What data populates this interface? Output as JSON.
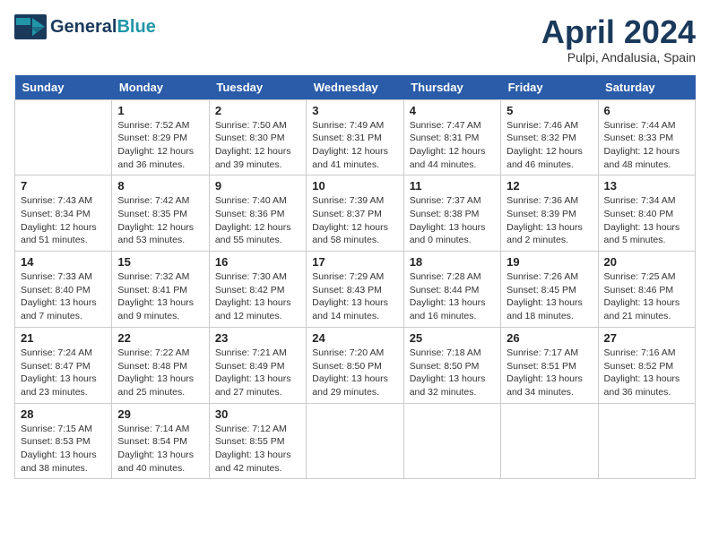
{
  "header": {
    "logo_general": "General",
    "logo_blue": "Blue",
    "month_title": "April 2024",
    "location": "Pulpi, Andalusia, Spain"
  },
  "days_of_week": [
    "Sunday",
    "Monday",
    "Tuesday",
    "Wednesday",
    "Thursday",
    "Friday",
    "Saturday"
  ],
  "weeks": [
    [
      {
        "day": "",
        "sunrise": "",
        "sunset": "",
        "daylight": ""
      },
      {
        "day": "1",
        "sunrise": "Sunrise: 7:52 AM",
        "sunset": "Sunset: 8:29 PM",
        "daylight": "Daylight: 12 hours and 36 minutes."
      },
      {
        "day": "2",
        "sunrise": "Sunrise: 7:50 AM",
        "sunset": "Sunset: 8:30 PM",
        "daylight": "Daylight: 12 hours and 39 minutes."
      },
      {
        "day": "3",
        "sunrise": "Sunrise: 7:49 AM",
        "sunset": "Sunset: 8:31 PM",
        "daylight": "Daylight: 12 hours and 41 minutes."
      },
      {
        "day": "4",
        "sunrise": "Sunrise: 7:47 AM",
        "sunset": "Sunset: 8:31 PM",
        "daylight": "Daylight: 12 hours and 44 minutes."
      },
      {
        "day": "5",
        "sunrise": "Sunrise: 7:46 AM",
        "sunset": "Sunset: 8:32 PM",
        "daylight": "Daylight: 12 hours and 46 minutes."
      },
      {
        "day": "6",
        "sunrise": "Sunrise: 7:44 AM",
        "sunset": "Sunset: 8:33 PM",
        "daylight": "Daylight: 12 hours and 48 minutes."
      }
    ],
    [
      {
        "day": "7",
        "sunrise": "Sunrise: 7:43 AM",
        "sunset": "Sunset: 8:34 PM",
        "daylight": "Daylight: 12 hours and 51 minutes."
      },
      {
        "day": "8",
        "sunrise": "Sunrise: 7:42 AM",
        "sunset": "Sunset: 8:35 PM",
        "daylight": "Daylight: 12 hours and 53 minutes."
      },
      {
        "day": "9",
        "sunrise": "Sunrise: 7:40 AM",
        "sunset": "Sunset: 8:36 PM",
        "daylight": "Daylight: 12 hours and 55 minutes."
      },
      {
        "day": "10",
        "sunrise": "Sunrise: 7:39 AM",
        "sunset": "Sunset: 8:37 PM",
        "daylight": "Daylight: 12 hours and 58 minutes."
      },
      {
        "day": "11",
        "sunrise": "Sunrise: 7:37 AM",
        "sunset": "Sunset: 8:38 PM",
        "daylight": "Daylight: 13 hours and 0 minutes."
      },
      {
        "day": "12",
        "sunrise": "Sunrise: 7:36 AM",
        "sunset": "Sunset: 8:39 PM",
        "daylight": "Daylight: 13 hours and 2 minutes."
      },
      {
        "day": "13",
        "sunrise": "Sunrise: 7:34 AM",
        "sunset": "Sunset: 8:40 PM",
        "daylight": "Daylight: 13 hours and 5 minutes."
      }
    ],
    [
      {
        "day": "14",
        "sunrise": "Sunrise: 7:33 AM",
        "sunset": "Sunset: 8:40 PM",
        "daylight": "Daylight: 13 hours and 7 minutes."
      },
      {
        "day": "15",
        "sunrise": "Sunrise: 7:32 AM",
        "sunset": "Sunset: 8:41 PM",
        "daylight": "Daylight: 13 hours and 9 minutes."
      },
      {
        "day": "16",
        "sunrise": "Sunrise: 7:30 AM",
        "sunset": "Sunset: 8:42 PM",
        "daylight": "Daylight: 13 hours and 12 minutes."
      },
      {
        "day": "17",
        "sunrise": "Sunrise: 7:29 AM",
        "sunset": "Sunset: 8:43 PM",
        "daylight": "Daylight: 13 hours and 14 minutes."
      },
      {
        "day": "18",
        "sunrise": "Sunrise: 7:28 AM",
        "sunset": "Sunset: 8:44 PM",
        "daylight": "Daylight: 13 hours and 16 minutes."
      },
      {
        "day": "19",
        "sunrise": "Sunrise: 7:26 AM",
        "sunset": "Sunset: 8:45 PM",
        "daylight": "Daylight: 13 hours and 18 minutes."
      },
      {
        "day": "20",
        "sunrise": "Sunrise: 7:25 AM",
        "sunset": "Sunset: 8:46 PM",
        "daylight": "Daylight: 13 hours and 21 minutes."
      }
    ],
    [
      {
        "day": "21",
        "sunrise": "Sunrise: 7:24 AM",
        "sunset": "Sunset: 8:47 PM",
        "daylight": "Daylight: 13 hours and 23 minutes."
      },
      {
        "day": "22",
        "sunrise": "Sunrise: 7:22 AM",
        "sunset": "Sunset: 8:48 PM",
        "daylight": "Daylight: 13 hours and 25 minutes."
      },
      {
        "day": "23",
        "sunrise": "Sunrise: 7:21 AM",
        "sunset": "Sunset: 8:49 PM",
        "daylight": "Daylight: 13 hours and 27 minutes."
      },
      {
        "day": "24",
        "sunrise": "Sunrise: 7:20 AM",
        "sunset": "Sunset: 8:50 PM",
        "daylight": "Daylight: 13 hours and 29 minutes."
      },
      {
        "day": "25",
        "sunrise": "Sunrise: 7:18 AM",
        "sunset": "Sunset: 8:50 PM",
        "daylight": "Daylight: 13 hours and 32 minutes."
      },
      {
        "day": "26",
        "sunrise": "Sunrise: 7:17 AM",
        "sunset": "Sunset: 8:51 PM",
        "daylight": "Daylight: 13 hours and 34 minutes."
      },
      {
        "day": "27",
        "sunrise": "Sunrise: 7:16 AM",
        "sunset": "Sunset: 8:52 PM",
        "daylight": "Daylight: 13 hours and 36 minutes."
      }
    ],
    [
      {
        "day": "28",
        "sunrise": "Sunrise: 7:15 AM",
        "sunset": "Sunset: 8:53 PM",
        "daylight": "Daylight: 13 hours and 38 minutes."
      },
      {
        "day": "29",
        "sunrise": "Sunrise: 7:14 AM",
        "sunset": "Sunset: 8:54 PM",
        "daylight": "Daylight: 13 hours and 40 minutes."
      },
      {
        "day": "30",
        "sunrise": "Sunrise: 7:12 AM",
        "sunset": "Sunset: 8:55 PM",
        "daylight": "Daylight: 13 hours and 42 minutes."
      },
      {
        "day": "",
        "sunrise": "",
        "sunset": "",
        "daylight": ""
      },
      {
        "day": "",
        "sunrise": "",
        "sunset": "",
        "daylight": ""
      },
      {
        "day": "",
        "sunrise": "",
        "sunset": "",
        "daylight": ""
      },
      {
        "day": "",
        "sunrise": "",
        "sunset": "",
        "daylight": ""
      }
    ]
  ]
}
